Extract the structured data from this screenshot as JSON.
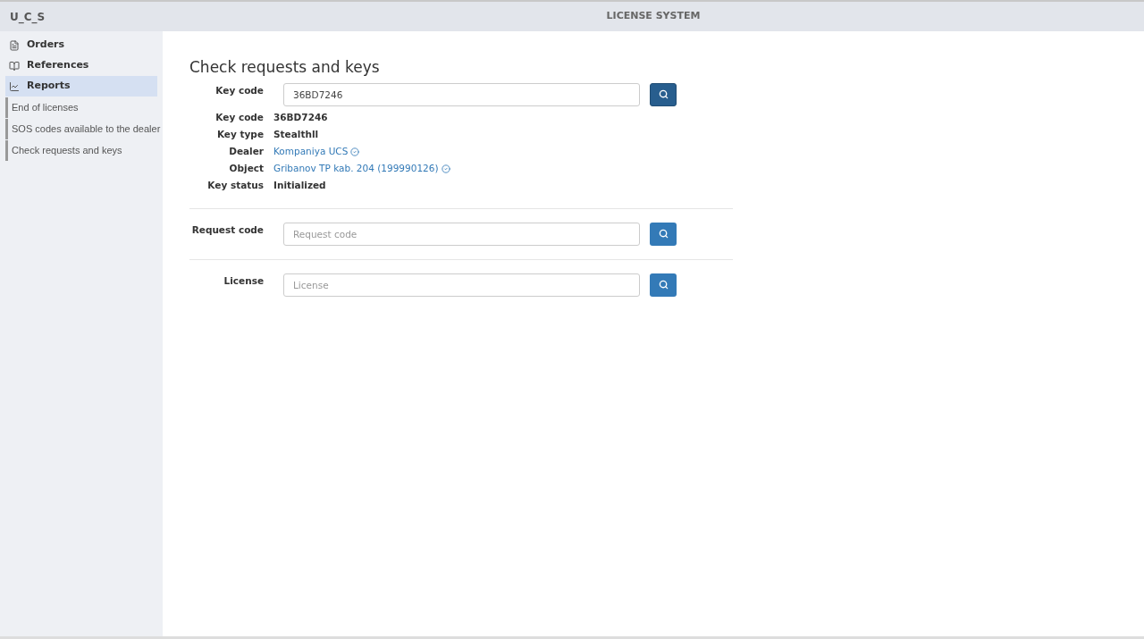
{
  "header": {
    "brand": "U_C_S",
    "title": "LICENSE SYSTEM"
  },
  "sidebar": {
    "items": [
      {
        "label": "Orders",
        "selected": false
      },
      {
        "label": "References",
        "selected": false
      },
      {
        "label": "Reports",
        "selected": true,
        "children": [
          {
            "label": "End of licenses"
          },
          {
            "label": "SOS codes available to the dealer"
          },
          {
            "label": "Check requests and keys"
          }
        ]
      }
    ]
  },
  "page_title": "Check requests and keys",
  "sections": [
    {
      "label": "Key code",
      "value": "36BD7246",
      "button_active": true,
      "details": [
        {
          "label": "Key code",
          "value": "36BD7246",
          "kind": "text"
        },
        {
          "label": "Key type",
          "value": "Stealthll",
          "kind": "text"
        },
        {
          "label": "Dealer",
          "value": "Kompaniya UCS",
          "kind": "link"
        },
        {
          "label": "Object",
          "value": "Gribanov TP kab. 204 (199990126)",
          "kind": "link"
        },
        {
          "label": "Key status",
          "value": "Initialized",
          "kind": "text"
        }
      ]
    },
    {
      "label": "Request code",
      "placeholder": "Request code",
      "button_active": false
    },
    {
      "label": "License",
      "placeholder": "License",
      "button_active": false
    }
  ]
}
